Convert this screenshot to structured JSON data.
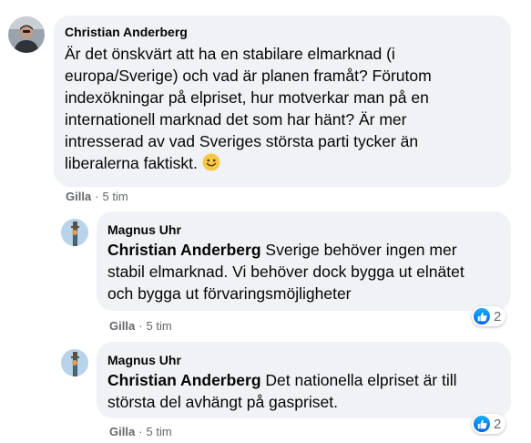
{
  "comments": [
    {
      "author": "Christian Anderberg",
      "text_lines": [
        "Är det önskvärt att ha en stabilare elmarknad (i",
        "europa/Sverige) och vad är planen framåt? Förutom",
        "indexökningar på elpriset, hur motverkar man på en",
        "internationell marknad det som har hänt? Är mer",
        "intresserad av vad Sveriges största parti tycker än",
        "liberalerna faktiskt."
      ],
      "emoji": "slightly-smiling-face",
      "like_label": "Gilla",
      "separator": "·",
      "time": "5 tim"
    }
  ],
  "replies": [
    {
      "author": "Magnus Uhr",
      "mention": "Christian Anderberg",
      "line1_rest": " Sverige behöver ingen mer",
      "line2": "stabil elmarknad. Vi behöver dock bygga ut elnätet",
      "line3": "och bygga ut förvaringsmöjligheter",
      "like_label": "Gilla",
      "separator": "·",
      "time": "5 tim",
      "reaction_count": "2",
      "reaction_icon": "thumbs-up-icon"
    },
    {
      "author": "Magnus Uhr",
      "mention": "Christian Anderberg",
      "line1_rest": " Det nationella elpriset är till",
      "line2": "största del avhängt på gaspriset.",
      "like_label": "Gilla",
      "separator": "·",
      "time": "5 tim",
      "reaction_count": "2",
      "reaction_icon": "thumbs-up-icon"
    }
  ],
  "colors": {
    "bubble": "#f0f2f5",
    "meta": "#65676b",
    "like_blue": "#1877f2"
  }
}
